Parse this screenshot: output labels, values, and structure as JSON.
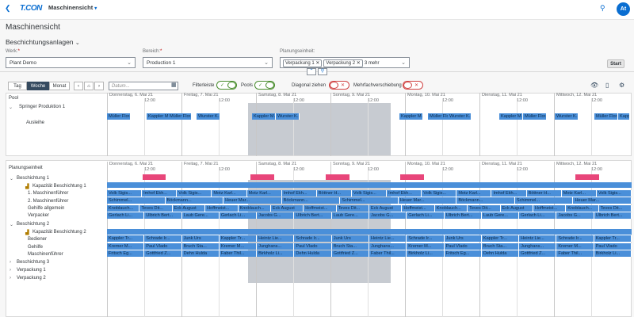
{
  "app": {
    "logo": "T.CON",
    "title": "Maschinensicht",
    "avatar": "At"
  },
  "page": {
    "title": "Maschinensicht",
    "section": "Beschichtungsanlagen"
  },
  "filters": {
    "werk": {
      "label": "Werk:",
      "value": "Plant Demo"
    },
    "bereich": {
      "label": "Bereich:",
      "value": "Production 1"
    },
    "planung": {
      "label": "Planungseinheit:",
      "tokens": [
        "Verpackung 1",
        "Verpackung 2"
      ],
      "more": "3 mehr"
    },
    "start": "Start"
  },
  "toolbar": {
    "tag": "Tag",
    "woche": "Woche",
    "monat": "Monat",
    "date_placeholder": "Datum...",
    "filterleiste": "Filterleiste",
    "pools": "Pools",
    "diagonal": "Diagonal ziehen",
    "mehrfach": "Mehrfachverschiebung"
  },
  "pool": {
    "header": "Pool",
    "group": "Springer Produktion 1",
    "row": "Ausleihe"
  },
  "days": [
    "Donnerstag, 6. Mai 21",
    "Freitag, 7. Mai 21",
    "Samstag, 8. Mai 21",
    "Sonntag, 9. Mai 21",
    "Montag, 10. Mai 21",
    "Dienstag, 11. Mai 21",
    "Mittwoch, 12. Mai 21"
  ],
  "noon": "12:00",
  "pool_bars": [
    "Müller Flor...",
    "Kappler M...",
    "Müller Flor...",
    "Wurster K...",
    "Kappler M...",
    "Wurster K...",
    "Kappler M...",
    "Müller Flor...",
    "Wurster K...",
    "Kappler M...",
    "Müller Flor...",
    "Wurster K...",
    "Müller Flor...",
    "Kappler M..."
  ],
  "plan": {
    "header": "Planungseinheit",
    "rows": [
      "Beschichtung 1",
      "Kapazität Beschichtung 1",
      "1. Maschinenführer",
      "2. Maschinenführer",
      "Gehilfe allgemein",
      "Verpacker",
      "Beschichtung 2",
      "Kapazität Beschichtung 2",
      "Bediener",
      "Gehilfe",
      "Maschinenführer",
      "Beschichtung 3",
      "Verpackung 1",
      "Verpackung 2"
    ]
  },
  "bars": {
    "r1": [
      "Volk Sigis...",
      "Imhof Ekh...",
      "Volk Sigis...",
      "Motz Karl...",
      "Motz Karl...",
      "Imhof Ekh...",
      "Böttner H...",
      "Volk Sigis...",
      "Imhof Ekh...",
      "Volk Sigis...",
      "Motz Karl...",
      "Imhof Ekh...",
      "Böttner H...",
      "Motz Karl...",
      "Volk Sigis..."
    ],
    "r2": [
      "Schimmel...",
      "Böckmann...",
      "Heuer Mar...",
      "Böckmann...",
      "Schimmel...",
      "Heuer Mar...",
      "Böckmann...",
      "Schimmel...",
      "Heuer Mar..."
    ],
    "r3": [
      "Knoblauch...",
      "Teves Dit...",
      "Eck August",
      "Hoffmeist...",
      "Knoblauch...",
      "Eck August",
      "Hoffmeist...",
      "Teves Dit...",
      "Eck August",
      "Hoffmeist...",
      "Knoblauch...",
      "Teves Dit...",
      "Eck August",
      "Hoffmeist...",
      "Knoblauch...",
      "Teves Dit..."
    ],
    "r4": [
      "Gerlach Li...",
      "Ulbrich Bert...",
      "Laub Gere...",
      "Gerlach Li...",
      "Jacobs G...",
      "Ulbrich Bert...",
      "Laub Gere...",
      "Jacobs G...",
      "Gerlach Li...",
      "Ulbrich Bert...",
      "Laub Gere...",
      "Gerlach Li...",
      "Jacobs G...",
      "Ulbrich Bert..."
    ],
    "r5": [
      "Kappler Tr...",
      "Schrade Ir...",
      "Junk Urs",
      "Kappler Tr...",
      "Heintz Lie...",
      "Schrade Ir...",
      "Junk Urs",
      "Heintz Lie...",
      "Schrade Ir...",
      "Junk Urs",
      "Kappler Tr...",
      "Heintz Lie...",
      "Schrade Ir...",
      "Kappler Tr..."
    ],
    "r6": [
      "Kremer M...",
      "Paul Vlado",
      "Bruch Sta...",
      "Kremer M...",
      "Junghans...",
      "Paul Vlado",
      "Bruch Sta...",
      "Junghans...",
      "Kremer M...",
      "Paul Vlado",
      "Bruch Sta...",
      "Junghans...",
      "Kremer M...",
      "Paul Vlado"
    ],
    "r7": [
      "Fritsch Eg...",
      "Gottfried Z...",
      "Dehn Hulda",
      "Faber Thil...",
      "Birkholz Li...",
      "Dehn Hulda",
      "Gottfried Z...",
      "Faber Thil...",
      "Birkholz Li...",
      "Fritsch Eg...",
      "Dehn Hulda",
      "Gottfried Z...",
      "Faber Thil...",
      "Birkholz Li..."
    ]
  }
}
